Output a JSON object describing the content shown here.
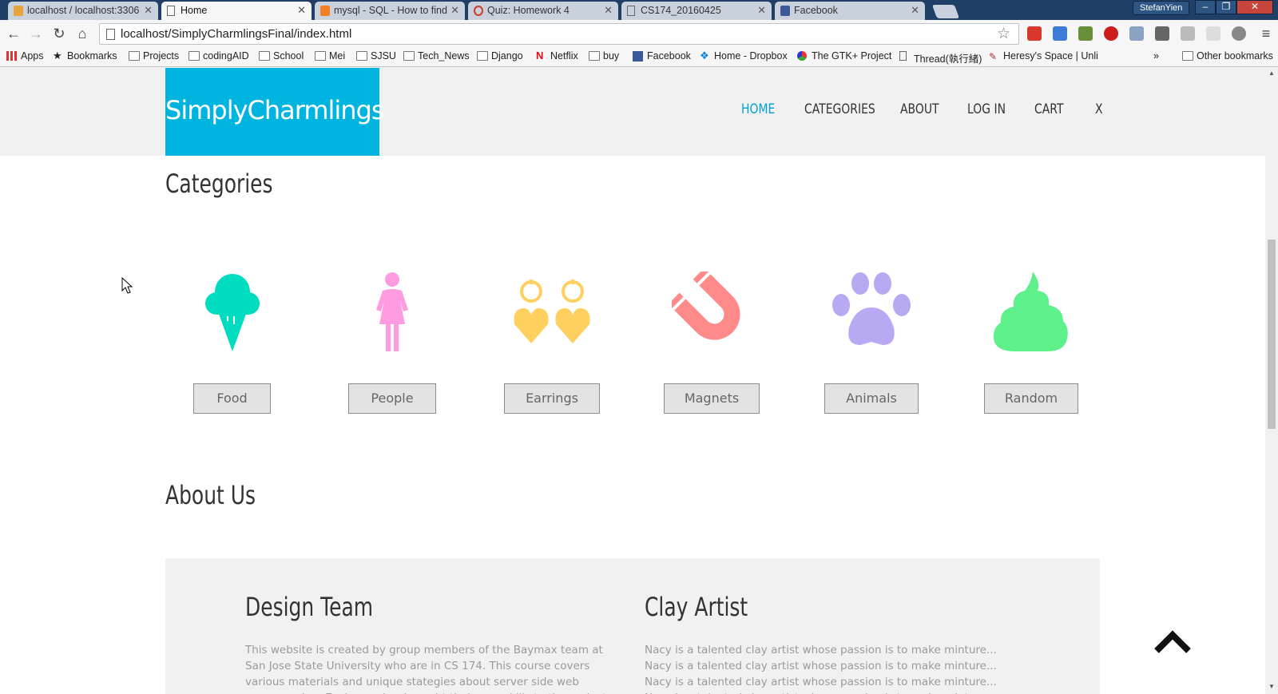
{
  "browser": {
    "tabs": [
      {
        "title": "localhost / localhost:3306",
        "active": false
      },
      {
        "title": "Home",
        "active": true
      },
      {
        "title": "mysql - SQL - How to find",
        "active": false
      },
      {
        "title": "Quiz: Homework 4",
        "active": false
      },
      {
        "title": "CS174_20160425",
        "active": false
      },
      {
        "title": "Facebook",
        "active": false
      }
    ],
    "profile_name": "StefanYien",
    "url": "localhost/SimplyCharmlingsFinal/index.html",
    "bookmarks": [
      {
        "label": "Apps",
        "icon": "apps-grid-icon"
      },
      {
        "label": "Bookmarks",
        "icon": "star-icon"
      },
      {
        "label": "Projects",
        "icon": "folder-icon"
      },
      {
        "label": "codingAID",
        "icon": "folder-icon"
      },
      {
        "label": "School",
        "icon": "folder-icon"
      },
      {
        "label": "Mei",
        "icon": "folder-icon"
      },
      {
        "label": "SJSU",
        "icon": "folder-icon"
      },
      {
        "label": "Tech_News",
        "icon": "folder-icon"
      },
      {
        "label": "Django",
        "icon": "folder-icon"
      },
      {
        "label": "Netflix",
        "icon": "netflix-icon"
      },
      {
        "label": "buy",
        "icon": "folder-icon"
      },
      {
        "label": "Facebook",
        "icon": "facebook-icon"
      },
      {
        "label": "Home - Dropbox",
        "icon": "dropbox-icon"
      },
      {
        "label": "The GTK+ Project",
        "icon": "gtk-icon"
      },
      {
        "label": "Thread(執行緒)",
        "icon": "page-icon"
      },
      {
        "label": "Heresy's Space | Unlin",
        "icon": "quill-icon"
      }
    ],
    "overflow_label": "»",
    "other_bookmarks": "Other bookmarks"
  },
  "site": {
    "logo": "SimplyCharmlings",
    "nav": [
      "HOME",
      "CATEGORIES",
      "ABOUT",
      "LOG IN",
      "CART",
      "X"
    ],
    "accent_color": "#00b4e0",
    "categories_title": "Categories",
    "categories": [
      {
        "label": "Food",
        "icon": "ice-cream-icon",
        "color": "#00dcc0"
      },
      {
        "label": "People",
        "icon": "person-icon",
        "color": "#ff9be0"
      },
      {
        "label": "Earrings",
        "icon": "heart-earrings-icon",
        "color": "#ffd060"
      },
      {
        "label": "Magnets",
        "icon": "magnet-icon",
        "color": "#ff8a8a"
      },
      {
        "label": "Animals",
        "icon": "paw-icon",
        "color": "#b9a8f2"
      },
      {
        "label": "Random",
        "icon": "swirl-icon",
        "color": "#5ef08a"
      }
    ],
    "about_title": "About Us",
    "about": [
      {
        "heading": "Design Team",
        "text": "This website is created by group members of the Baymax team at San Jose State University who are in CS 174. This course covers various materials and unique stategies about server side web programming. Each member brought their own skills to the project."
      },
      {
        "heading": "Clay Artist",
        "text": "Nacy is a talented clay artist whose passion is to make minture... Nacy is a talented clay artist whose passion is to make minture... Nacy is a talented clay artist whose passion is to make minture... Nacy is a talented clay artist whose passion is to make minture... Nacy is a talented clay artist whose"
      }
    ]
  }
}
